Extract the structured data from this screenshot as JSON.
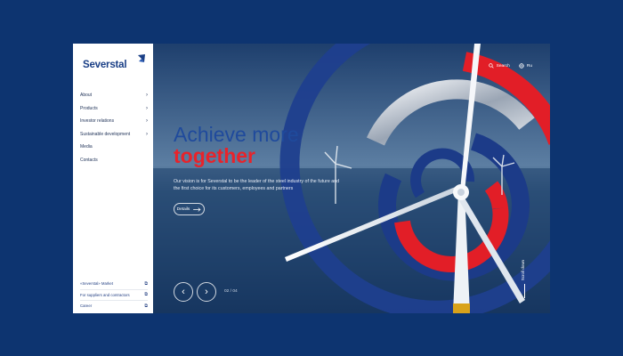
{
  "brand": {
    "name": "Severstal"
  },
  "sidebar": {
    "nav": [
      {
        "label": "About",
        "has_sub": true
      },
      {
        "label": "Products",
        "has_sub": true
      },
      {
        "label": "Investor relations",
        "has_sub": true
      },
      {
        "label": "Sustainable development",
        "has_sub": true
      },
      {
        "label": "Media",
        "has_sub": false
      },
      {
        "label": "Contacts",
        "has_sub": false
      }
    ],
    "footer_links": [
      {
        "label": "«Severstal» Market"
      },
      {
        "label": "For suppliers and contractors"
      },
      {
        "label": "Career"
      }
    ],
    "chevron": "›",
    "external_icon": "⧉"
  },
  "topbar": {
    "search_label": "Search",
    "lang_label": "Ru"
  },
  "hero": {
    "headline_line1": "Achieve more",
    "headline_line2": "together",
    "subtext": "Our vision is for Severstal to be the leader of the steel industry of the future and the first choice for its customers, employees and partners",
    "details_label": "Details",
    "pager": "02 / 04",
    "scroll_label": "Scroll down",
    "prev_glyph": "‹",
    "next_glyph": "›"
  },
  "colors": {
    "brand_blue": "#1f4a9c",
    "accent_red": "#e8232a",
    "page_bg": "#0d3470"
  }
}
